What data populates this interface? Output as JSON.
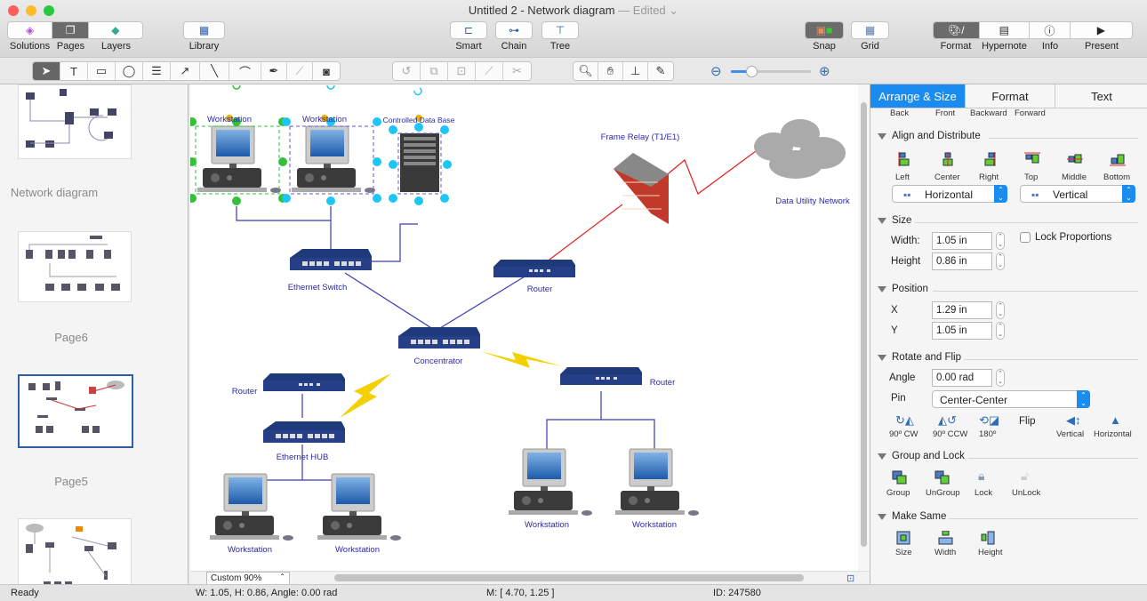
{
  "window": {
    "title": "Untitled 2 - Network diagram",
    "edited": "— Edited ⌄"
  },
  "toolbar": {
    "solutions": "Solutions",
    "pages": "Pages",
    "layers": "Layers",
    "library": "Library",
    "smart": "Smart",
    "chain": "Chain",
    "tree": "Tree",
    "snap": "Snap",
    "grid": "Grid",
    "format": "Format",
    "hypernote": "Hypernote",
    "info": "Info",
    "present": "Present"
  },
  "zoom": {
    "level_fraction": 0.25
  },
  "sidebar": {
    "pages": [
      {
        "label": "Network diagram"
      },
      {
        "label": "Page6"
      },
      {
        "label": "Page5"
      }
    ]
  },
  "canvas": {
    "labels": {
      "ws1": "Workstation",
      "ws2": "Workstation",
      "db": "Controlled Data Base",
      "frame_relay": "Frame Relay (T1/E1)",
      "cloud": "Data Utility Network",
      "switch": "Ethernet Switch",
      "router_top": "Router",
      "concentrator": "Concentrator",
      "router_left": "Router",
      "router_right": "Router",
      "hub": "Ethernet HUB",
      "ws3": "Workstation",
      "ws4": "Workstation",
      "ws5": "Workstation",
      "ws6": "Workstation"
    },
    "zoom_select": "Custom 90%"
  },
  "status": {
    "ready": "Ready",
    "dims": "W: 1.05,  H: 0.86,  Angle: 0.00 rad",
    "mouse": "M: [ 4.70, 1.25 ]",
    "id": "ID: 247580"
  },
  "panel": {
    "tabs": [
      "Arrange & Size",
      "Format",
      "Text"
    ],
    "order": [
      "Back",
      "Front",
      "Backward",
      "Forward"
    ],
    "align": {
      "title": "Align and Distribute",
      "buttons": [
        "Left",
        "Center",
        "Right",
        "Top",
        "Middle",
        "Bottom"
      ],
      "horizontal": "Horizontal",
      "vertical": "Vertical"
    },
    "size": {
      "title": "Size",
      "width_label": "Width:",
      "width": "1.05 in",
      "height_label": "Height",
      "height": "0.86 in",
      "lock": "Lock Proportions",
      "lock_checked": false
    },
    "position": {
      "title": "Position",
      "x_label": "X",
      "x": "1.29 in",
      "y_label": "Y",
      "y": "1.05 in"
    },
    "rotate": {
      "title": "Rotate and Flip",
      "angle_label": "Angle",
      "angle": "0.00 rad",
      "pin_label": "Pin",
      "pin": "Center-Center",
      "buttons": [
        "90º CW",
        "90º CCW",
        "180º"
      ],
      "flip": "Flip",
      "flip_buttons": [
        "Vertical",
        "Horizontal"
      ]
    },
    "group": {
      "title": "Group and Lock",
      "buttons": [
        "Group",
        "UnGroup",
        "Lock",
        "UnLock"
      ]
    },
    "same": {
      "title": "Make Same",
      "buttons": [
        "Size",
        "Width",
        "Height"
      ]
    }
  },
  "colors": {
    "accent": "#1a8cf0",
    "link": "#3a3ab8",
    "wan": "#e02020",
    "lightning": "#f5d000"
  }
}
